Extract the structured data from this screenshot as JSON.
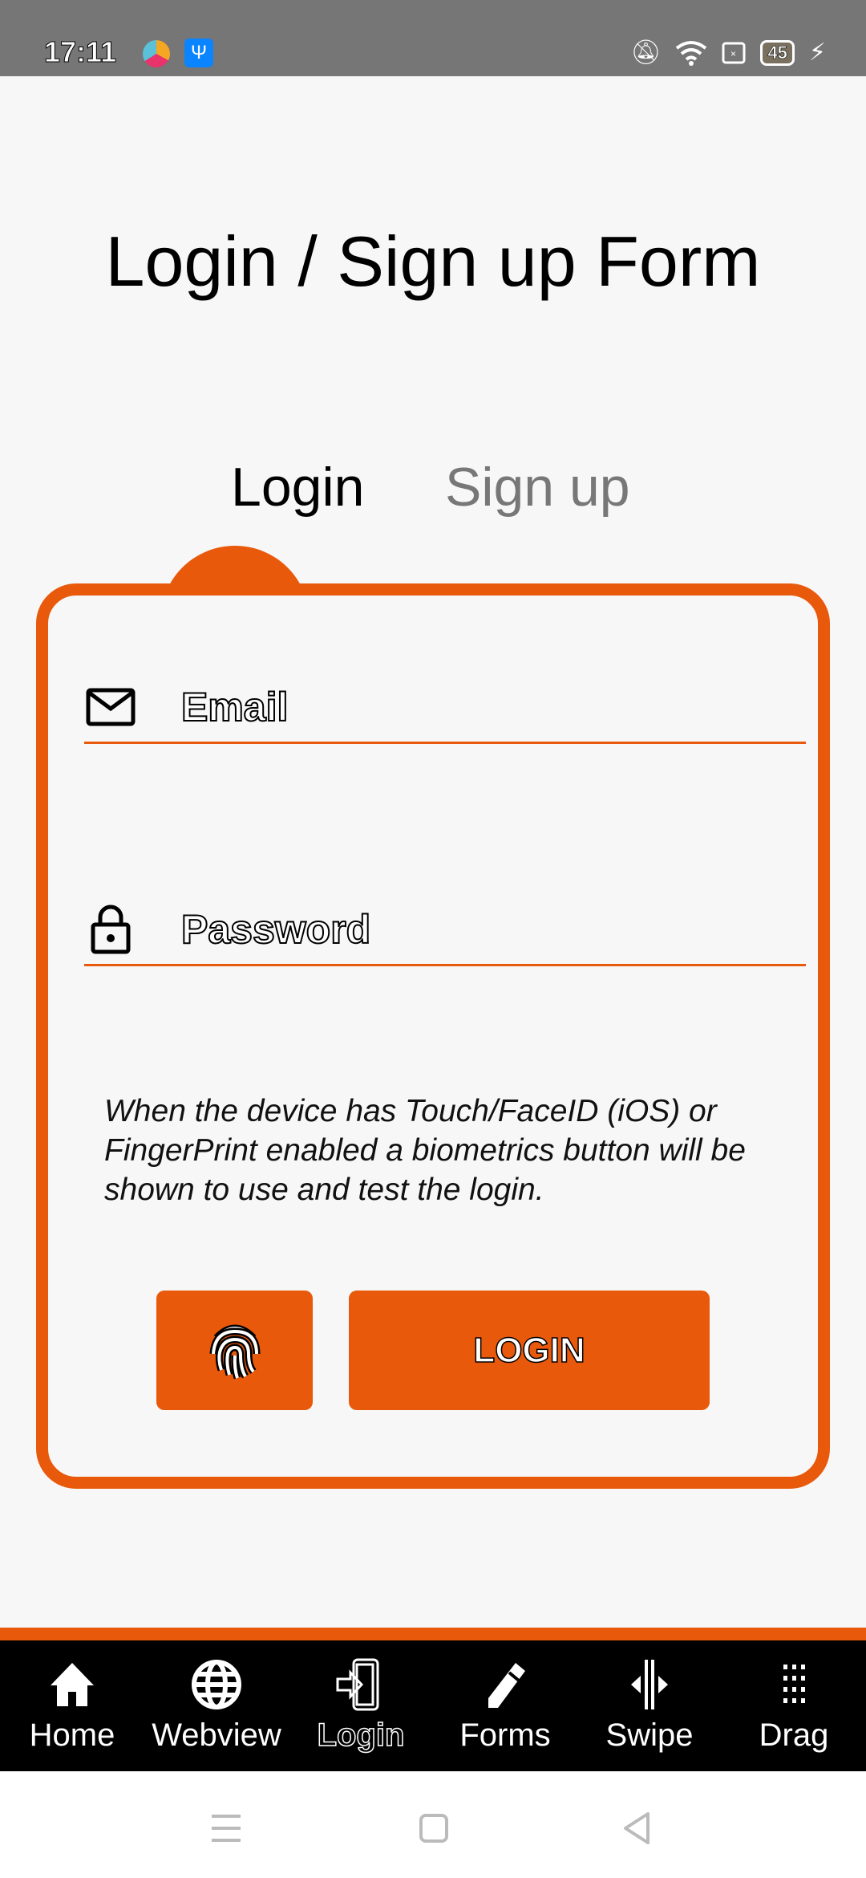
{
  "status": {
    "time": "17:11",
    "battery": "45"
  },
  "title": "Login / Sign up Form",
  "tabs": [
    {
      "label": "Login"
    },
    {
      "label": "Sign up"
    }
  ],
  "form": {
    "email_placeholder": "Email",
    "password_placeholder": "Password",
    "info": "When the device has Touch/FaceID (iOS) or FingerPrint enabled a biometrics button will be shown to use and test the login.",
    "login_label": "LOGIN"
  },
  "nav": [
    {
      "label": "Home",
      "icon": "home-icon"
    },
    {
      "label": "Webview",
      "icon": "globe-icon"
    },
    {
      "label": "Login",
      "icon": "login-icon"
    },
    {
      "label": "Forms",
      "icon": "pencil-icon"
    },
    {
      "label": "Swipe",
      "icon": "swipe-icon"
    },
    {
      "label": "Drag",
      "icon": "drag-icon"
    }
  ],
  "colors": {
    "accent": "#e8590c",
    "nav_bg": "#000000"
  }
}
